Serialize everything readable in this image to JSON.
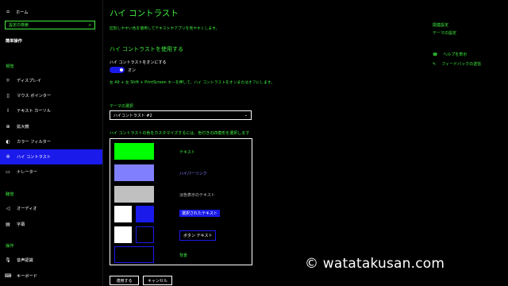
{
  "sidebar": {
    "home_label": "ホーム",
    "search_placeholder": "設定の検索",
    "section_title": "簡単操作",
    "group_vision": "視覚",
    "vision_items": [
      {
        "icon": "display-icon",
        "label": "ディスプレイ"
      },
      {
        "icon": "mouse-pointer-icon",
        "label": "マウス ポインター"
      },
      {
        "icon": "text-cursor-icon",
        "label": "テキスト カーソル"
      },
      {
        "icon": "magnifier-icon",
        "label": "拡大鏡"
      },
      {
        "icon": "color-filter-icon",
        "label": "カラー フィルター"
      },
      {
        "icon": "high-contrast-icon",
        "label": "ハイ コントラスト",
        "selected": true
      },
      {
        "icon": "narrator-icon",
        "label": "ナレーター"
      }
    ],
    "group_hearing": "聴覚",
    "hearing_items": [
      {
        "icon": "speaker-icon",
        "label": "オーディオ"
      },
      {
        "icon": "captions-icon",
        "label": "字幕"
      }
    ],
    "group_interaction": "操作",
    "interaction_items": [
      {
        "icon": "microphone-icon",
        "label": "音声認識"
      },
      {
        "icon": "keyboard-icon",
        "label": "キーボード"
      }
    ]
  },
  "main": {
    "title": "ハイ コントラスト",
    "description": "区別しやすい色を使用してテキストやアプリを見やすくします。",
    "section_title": "ハイ コントラストを使用する",
    "toggle_label": "ハイ コントラストをオンにする",
    "toggle_state": "オン",
    "hint": "左 Alt + 左 Shift + PrintScreen キーを押して、ハイ コントラストをオンまたはオフにします。",
    "theme_label": "テーマの選択",
    "theme_value": "ハイコントラスト #2",
    "customize_label": "ハイ コントラストの色をカスタマイズするには、色付きの四角形を選択します",
    "swatches": {
      "text": "テキスト",
      "hyperlink": "ハイパーリンク",
      "disabled_text": "淡色表示のテキスト",
      "selected_text": "選択されたテキスト",
      "button_text": "ボタン テキスト",
      "background": "背景"
    },
    "apply_button": "適用する",
    "cancel_button": "キャンセル"
  },
  "related": {
    "title": "関連設定",
    "theme_settings": "テーマの設定",
    "help": "ヘルプを表示",
    "feedback": "フィードバックの送信"
  },
  "watermark": "© watatakusan.com",
  "colors": {
    "accent_green": "#3ff03f",
    "selection_blue": "#1a1aeb",
    "hyperlink_purple": "#8080ff",
    "disabled_gray": "#c0c0c0",
    "background": "#000000"
  }
}
